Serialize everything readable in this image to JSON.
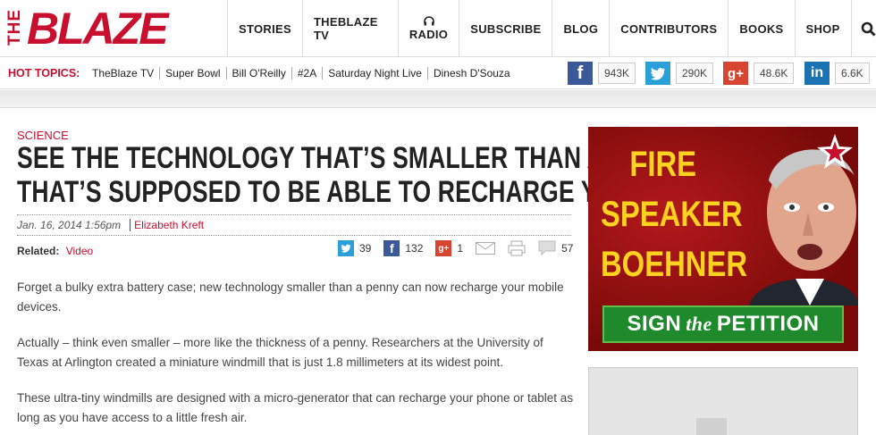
{
  "logo": {
    "small": "THE",
    "main": "BLAZE"
  },
  "nav": {
    "items": [
      {
        "label": "STORIES"
      },
      {
        "label": "THEBLAZE TV"
      },
      {
        "label": "RADIO"
      },
      {
        "label": "SUBSCRIBE"
      },
      {
        "label": "BLOG"
      },
      {
        "label": "CONTRIBUTORS"
      },
      {
        "label": "BOOKS"
      },
      {
        "label": "SHOP"
      }
    ],
    "icons": [
      "search-icon",
      "user-icon",
      "headphones-icon"
    ]
  },
  "hot_topics": {
    "label": "HOT TOPICS:",
    "links": [
      "TheBlaze TV",
      "Super Bowl",
      "Bill O'Reilly",
      "#2A",
      "Saturday Night Live",
      "Dinesh D'Souza"
    ]
  },
  "social": {
    "facebook": {
      "icon": "facebook-icon",
      "count": "943K",
      "color": "#3b5998"
    },
    "twitter": {
      "icon": "twitter-icon",
      "count": "290K",
      "color": "#2ba0d8"
    },
    "googleplus": {
      "icon": "googleplus-icon",
      "count": "48.6K",
      "color": "#d5452f"
    },
    "linkedin": {
      "icon": "linkedin-icon",
      "count": "6.6K",
      "color": "#1b73b3"
    }
  },
  "article": {
    "category": "SCIENCE",
    "headline_line1": "SEE THE TECHNOLOGY THAT’S SMALLER THAN A PENNY",
    "headline_line2": "THAT’S SUPPOSED TO BE ABLE TO RECHARGE YOUR PHONE",
    "date": "Jan. 16, 2014 1:56pm",
    "author": "Elizabeth Kreft",
    "related_label": "Related:",
    "related_link": "Video",
    "shares": {
      "twitter": "39",
      "facebook": "132",
      "googleplus": "1",
      "comments": "57"
    },
    "paragraphs": [
      "Forget a bulky extra battery case; new technology smaller than a penny can now recharge your mobile devices.",
      "Actually – think even smaller – more like the thickness of a penny. Researchers at the University of Texas at Arlington created a miniature windmill that is just 1.8 millimeters at its widest point.",
      "These ultra-tiny windmills are designed with a micro-generator that can recharge your phone or tablet as long as you have access to a little fresh air."
    ]
  },
  "ad": {
    "line1": "FIRE",
    "line2": "SPEAKER",
    "line3": "BOEHNER",
    "button_part1": "SIGN",
    "button_part2": "the",
    "button_part3": "PETITION",
    "accent": "#ffd21f",
    "button_color": "#1f8a2c"
  },
  "colors": {
    "brand": "#c8102e"
  }
}
